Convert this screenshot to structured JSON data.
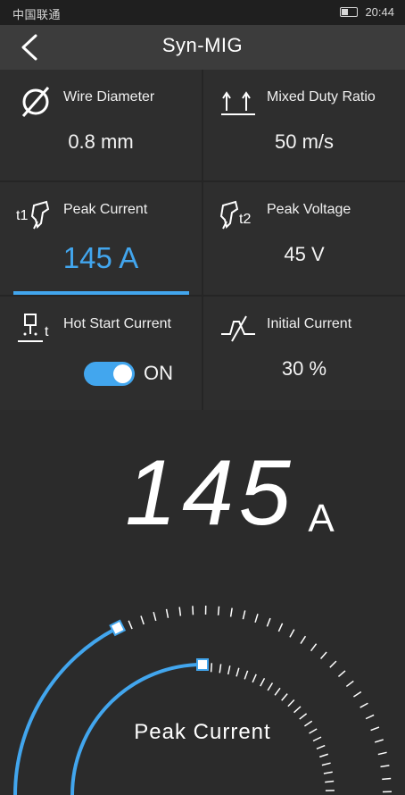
{
  "status_bar": {
    "carrier": "中国联通",
    "time": "20:44"
  },
  "header": {
    "title": "Syn-MIG",
    "back_icon": "back-arrow-icon"
  },
  "params": [
    {
      "label": "Wire Diameter",
      "value": "0.8 mm",
      "icon": "diameter-icon"
    },
    {
      "label": "Mixed Duty Ratio",
      "value": "50 m/s",
      "icon": "duty-ratio-icon"
    },
    {
      "label": "Peak Current",
      "value": "145 A",
      "icon": "peak-current-icon",
      "selected": true
    },
    {
      "label": "Peak Voltage",
      "value": "45 V",
      "icon": "peak-voltage-icon"
    },
    {
      "label": "Hot Start Current",
      "value": "ON",
      "icon": "hot-start-icon",
      "toggle_on": true
    },
    {
      "label": "Initial Current",
      "value": "30 %",
      "icon": "initial-current-icon"
    }
  ],
  "readout": {
    "value": "145",
    "unit": "A",
    "caption": "Peak Current"
  },
  "gauge": {
    "outer_level": 0.35,
    "inner_level": 0.5
  },
  "colors": {
    "accent": "#42a6ee",
    "panel": "#2e2e2e",
    "background": "#2a2a2a"
  }
}
